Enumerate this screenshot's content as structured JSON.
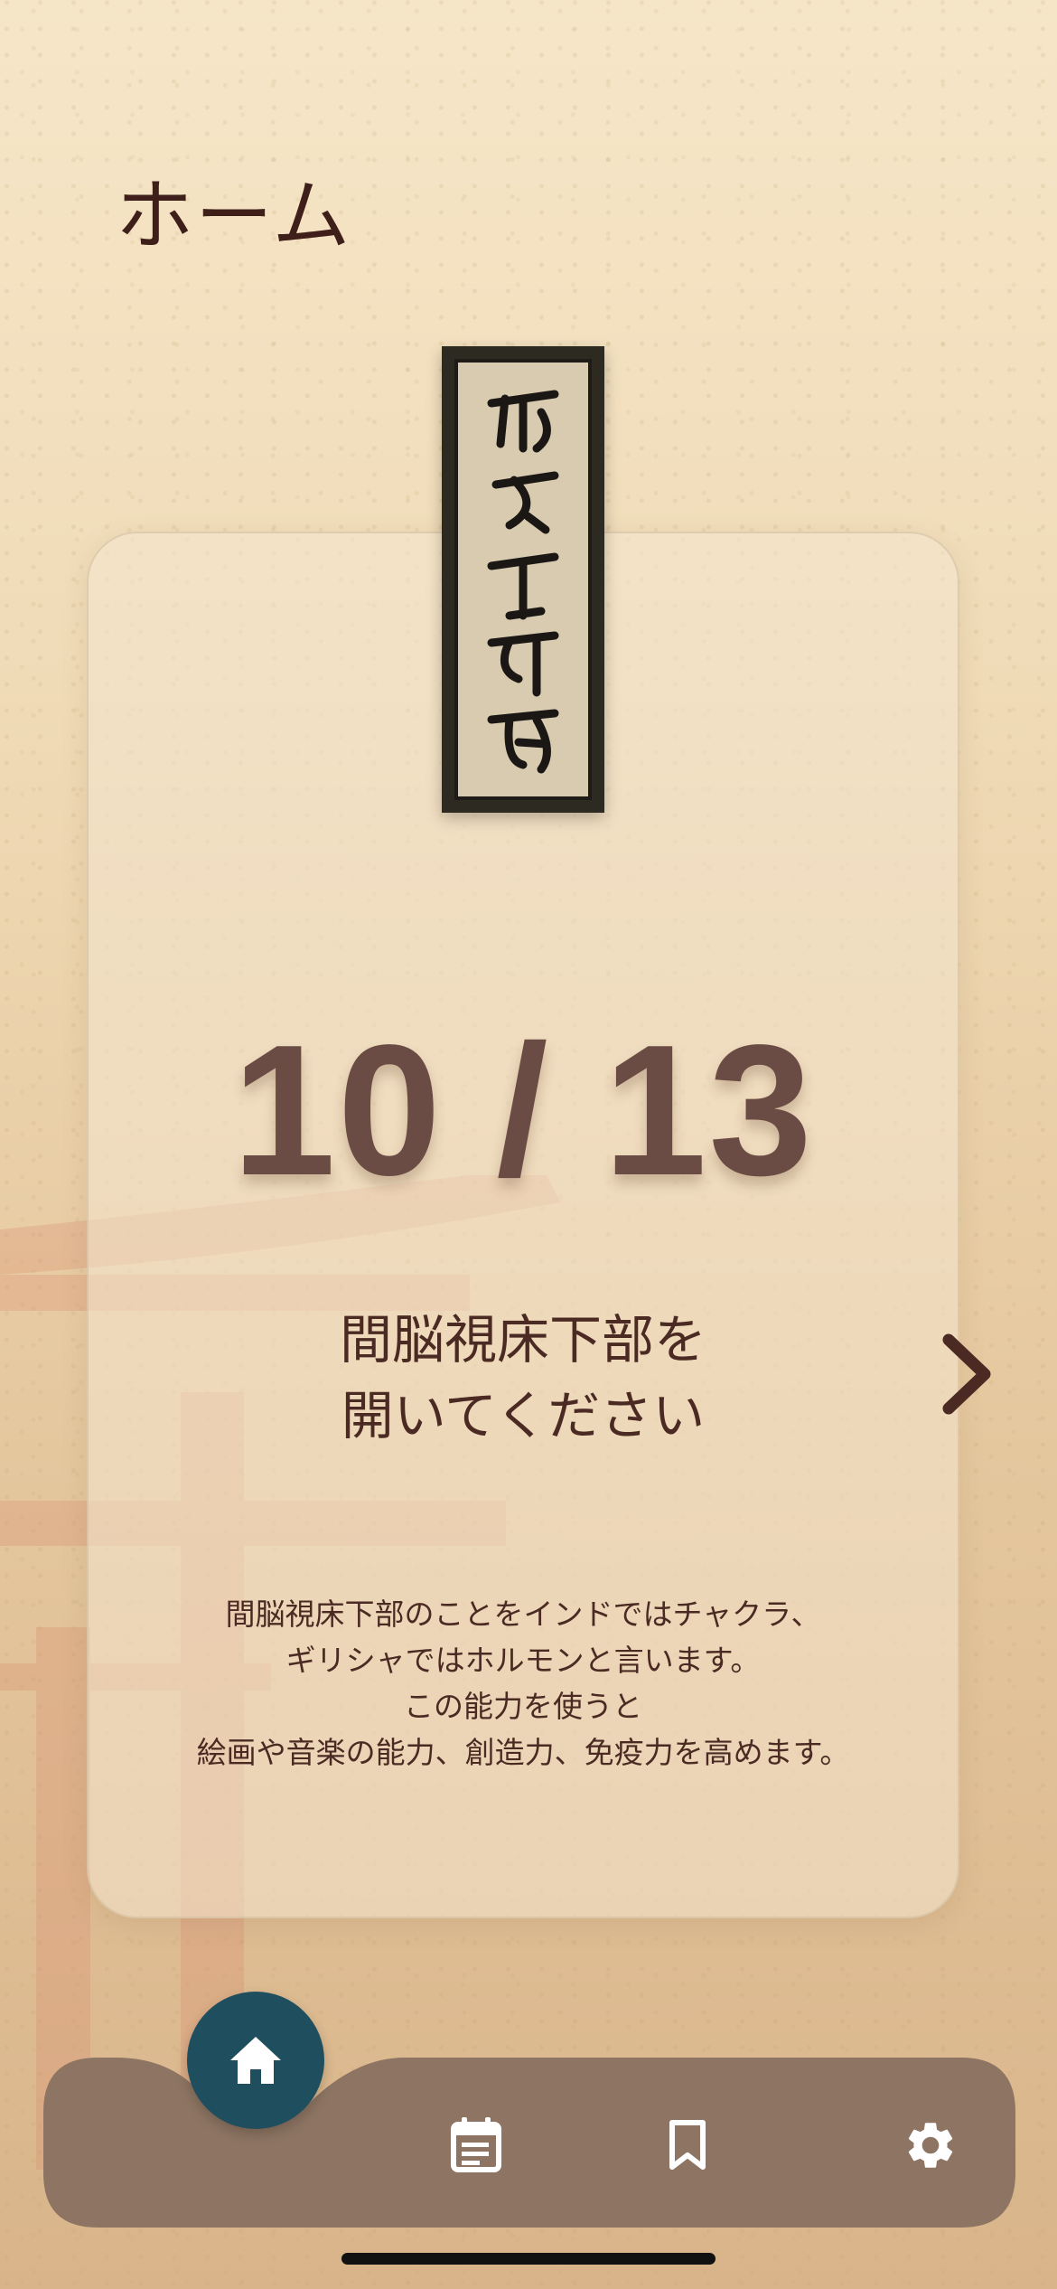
{
  "header": {
    "title": "ホーム"
  },
  "card": {
    "counter": "10 / 13",
    "headline_line1": "間脳視床下部を",
    "headline_line2": "開いてください",
    "description": [
      "間脳視床下部のことをインドではチャクラ、",
      "ギリシャではホルモンと言います。",
      "この能力を使うと",
      "絵画や音楽の能力、創造力、免疫力を高めます。"
    ]
  },
  "tabbar": {
    "items": [
      {
        "name": "home",
        "icon": "home-icon",
        "active": true
      },
      {
        "name": "calendar",
        "icon": "calendar-icon",
        "active": false
      },
      {
        "name": "bookmark",
        "icon": "bookmark-icon",
        "active": false
      },
      {
        "name": "settings",
        "icon": "gear-icon",
        "active": false
      }
    ]
  },
  "colors": {
    "title": "#3e1f1a",
    "counter": "#6b4c44",
    "tabbar": "#8e7563",
    "fab": "#1f4f5e"
  }
}
